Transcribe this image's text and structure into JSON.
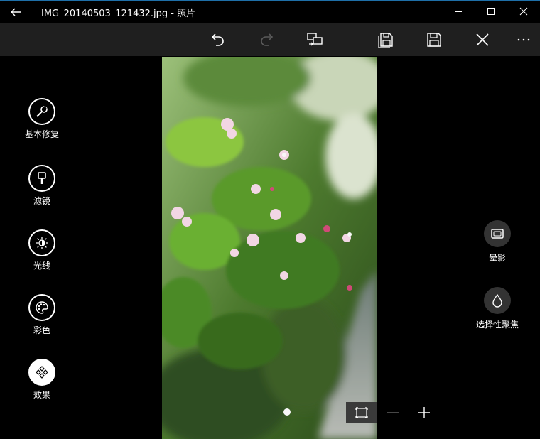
{
  "window": {
    "title": "IMG_20140503_121432.jpg - 照片",
    "back_icon": "arrow-left-icon",
    "controls": [
      "minimize-icon",
      "maximize-icon",
      "close-icon"
    ]
  },
  "toolbar": {
    "buttons": [
      {
        "name": "undo",
        "icon": "undo-icon",
        "enabled": true
      },
      {
        "name": "redo",
        "icon": "redo-icon",
        "enabled": false
      },
      {
        "name": "compare",
        "icon": "compare-icon",
        "enabled": true
      },
      {
        "name": "save-copy",
        "icon": "save-copy-icon",
        "enabled": true
      },
      {
        "name": "save",
        "icon": "save-icon",
        "enabled": true
      },
      {
        "name": "cancel",
        "icon": "close-icon",
        "enabled": true
      },
      {
        "name": "more",
        "icon": "more-icon",
        "enabled": true
      }
    ]
  },
  "left_tools": [
    {
      "label": "基本修复",
      "icon": "wrench-icon",
      "selected": false
    },
    {
      "label": "滤镜",
      "icon": "brush-icon",
      "selected": false
    },
    {
      "label": "光线",
      "icon": "sun-icon",
      "selected": false
    },
    {
      "label": "彩色",
      "icon": "palette-icon",
      "selected": false
    },
    {
      "label": "效果",
      "icon": "effects-icon",
      "selected": true
    }
  ],
  "right_tools": [
    {
      "label": "晕影",
      "icon": "vignette-icon"
    },
    {
      "label": "选择性聚焦",
      "icon": "drop-icon"
    }
  ],
  "photo": {
    "description_icon": "flowers-photo"
  },
  "zoom": {
    "buttons": [
      "fit-screen-icon",
      "zoom-out-icon",
      "zoom-in-icon"
    ]
  },
  "colors": {
    "toolbar_bg": "#1f1f1f",
    "window_bg": "#000000",
    "accent_border": "#1e6fa8"
  }
}
